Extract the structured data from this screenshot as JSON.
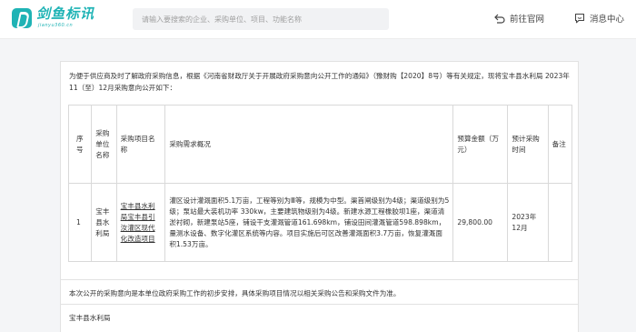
{
  "header": {
    "logo_name": "剑鱼标讯",
    "logo_domain": "jianyu360.cn",
    "search_placeholder": "请输入要搜索的企业、采购单位、项目、功能名称",
    "nav_official": "前往官网",
    "nav_messages": "消息中心"
  },
  "notice": {
    "intro": "为便于供应商及时了解政府采购信息，根据《河南省财政厅关于开展政府采购意向公开工作的通知》（豫财购【2020】8号）等有关规定，现将宝丰县水利局 2023年11（至）12月采购意向公开如下：",
    "table": {
      "headers": {
        "no": "序号",
        "unit": "采购单位名称",
        "name": "采购项目名称",
        "desc": "采购需求概况",
        "budget": "预算金额（万元）",
        "time": "预计采购时间",
        "note": "备注"
      },
      "rows": [
        {
          "no": "1",
          "unit": "宝丰县水利局",
          "name": "宝丰县水利局宝丰县引汝灌区现代化改造项目",
          "desc": "灌区设计灌溉面积5.1万亩，工程等别为Ⅲ等，规模为中型。渠首闸级别为4级；渠道级别为5级；泵站最大装机功率 330kw，主要建筑物级别为4级。新建水源工程橡胶坝1座，渠道清淤衬砌，新建泵站5座，铺设干支灌溉管道161.698km，铺设田间灌溉管道598.898km，量测水设备、数字化灌区系统等内容。项目实施后可区改善灌溉面积3.7万亩，恢复灌溉面积1.53万亩。",
          "budget": "29,800.00",
          "time": "2023年12月",
          "note": ""
        }
      ]
    },
    "footer_note": "本次公开的采购意向是本单位政府采购工作的初步安排，具体采购项目情况以相关采购公告和采购文件为准。",
    "footer_org": "宝丰县水利局"
  },
  "colors": {
    "brand": "#1fb3b5",
    "page_bg": "#f4f5f7",
    "border": "#d9d9d9"
  },
  "icons": [
    "logo-icon",
    "return-icon",
    "message-icon"
  ]
}
